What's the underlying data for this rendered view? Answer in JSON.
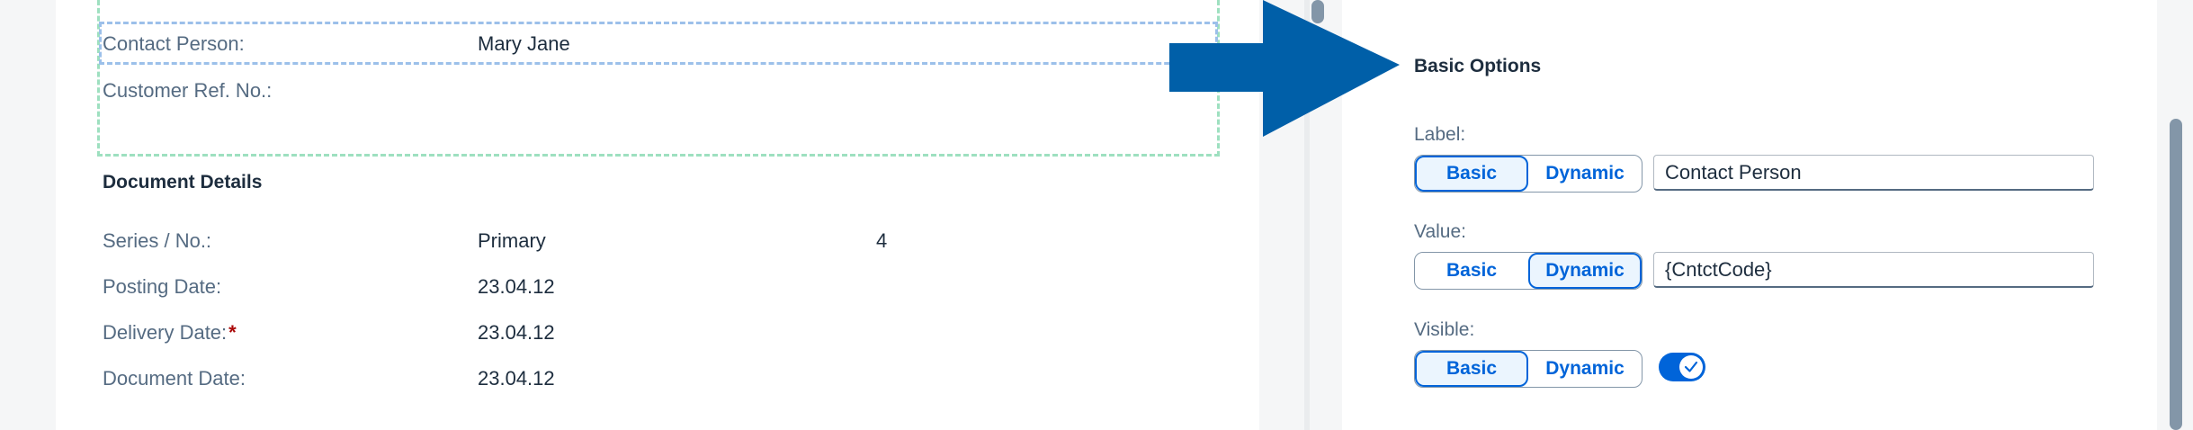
{
  "left": {
    "contact_person_label": "Contact Person:",
    "contact_person_value": "Mary Jane",
    "customer_ref_label": "Customer Ref. No.:",
    "document_details_title": "Document Details",
    "series_label": "Series / No.:",
    "series_value": "Primary",
    "series_number": "4",
    "posting_date_label": "Posting Date:",
    "posting_date_value": "23.04.12",
    "delivery_date_label": "Delivery Date:",
    "delivery_date_required": "*",
    "delivery_date_value": "23.04.12",
    "document_date_label": "Document Date:",
    "document_date_value": "23.04.12"
  },
  "right": {
    "section_title": "Basic Options",
    "label_field": {
      "label": "Label:",
      "basic": "Basic",
      "dynamic": "Dynamic",
      "active": "basic",
      "value": "Contact Person"
    },
    "value_field": {
      "label": "Value:",
      "basic": "Basic",
      "dynamic": "Dynamic",
      "active": "dynamic",
      "value": "{CntctCode}"
    },
    "visible_field": {
      "label": "Visible:",
      "basic": "Basic",
      "dynamic": "Dynamic",
      "active": "basic",
      "toggle_on": true
    }
  },
  "icons": {
    "arrow": "right-arrow-icon",
    "check": "check-icon"
  },
  "colors": {
    "accent": "#0064d9",
    "arrow": "#005fa8",
    "green_selection": "#9ee0c0",
    "blue_selection": "#9cc0ea",
    "required": "#aa0808"
  }
}
